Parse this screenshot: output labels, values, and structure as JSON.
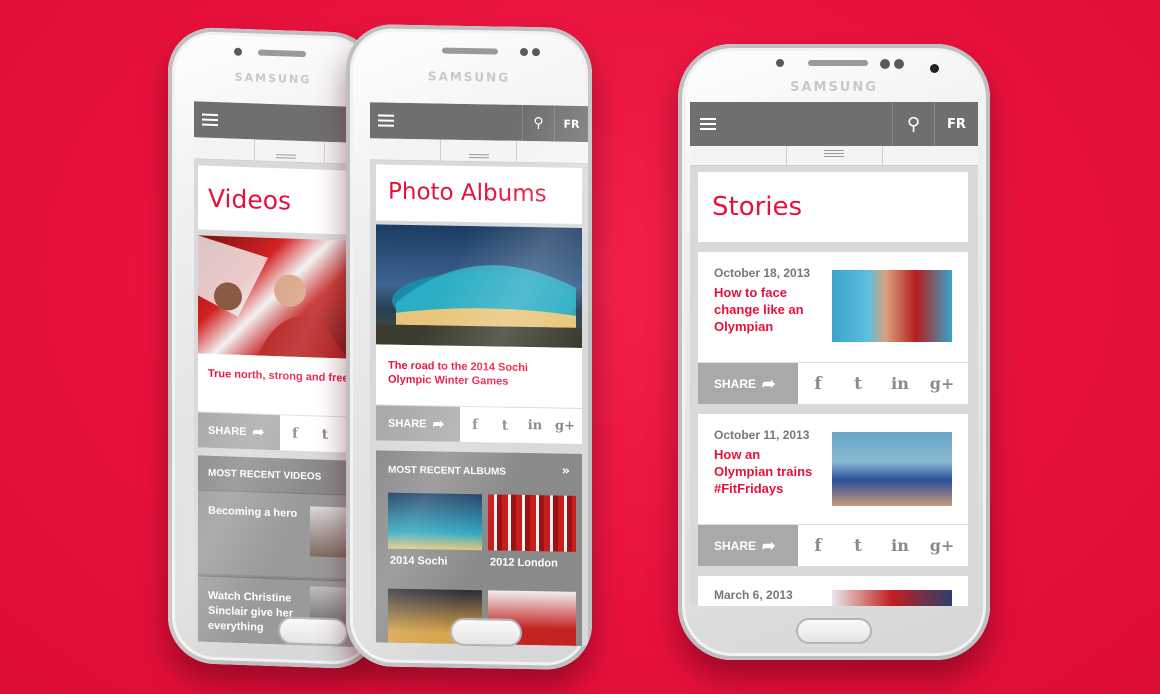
{
  "brand": "SAMSUNG",
  "topbar": {
    "lang": "FR"
  },
  "phone_videos": {
    "title": "Videos",
    "caption": "True north, strong and free",
    "share_label": "SHARE",
    "recent_heading": "MOST RECENT VIDEOS",
    "items": [
      {
        "label": "Becoming a hero"
      },
      {
        "label": "Watch Christine Sinclair give her everything"
      }
    ]
  },
  "phone_albums": {
    "title": "Photo Albums",
    "caption": "The road to the 2014 Sochi Olympic Winter Games",
    "share_label": "SHARE",
    "recent_heading": "MOST RECENT ALBUMS",
    "albums": [
      {
        "label": "2014 Sochi"
      },
      {
        "label": "2012 London"
      }
    ]
  },
  "phone_stories": {
    "title": "Stories",
    "share_label": "SHARE",
    "stories": [
      {
        "date": "October 18, 2013",
        "headline": "How to face change like an Olympian"
      },
      {
        "date": "October 11, 2013",
        "headline": "How an Olympian trains #FitFridays"
      },
      {
        "date": "March 6, 2013",
        "headline": ""
      }
    ]
  },
  "social": {
    "facebook": "f",
    "twitter": "t",
    "linkedin": "in",
    "googleplus": "g+"
  },
  "colors": {
    "accent": "#e8113d",
    "background": "#e8113d",
    "bar": "#6f6f6f",
    "share": "#a9a9a9"
  }
}
